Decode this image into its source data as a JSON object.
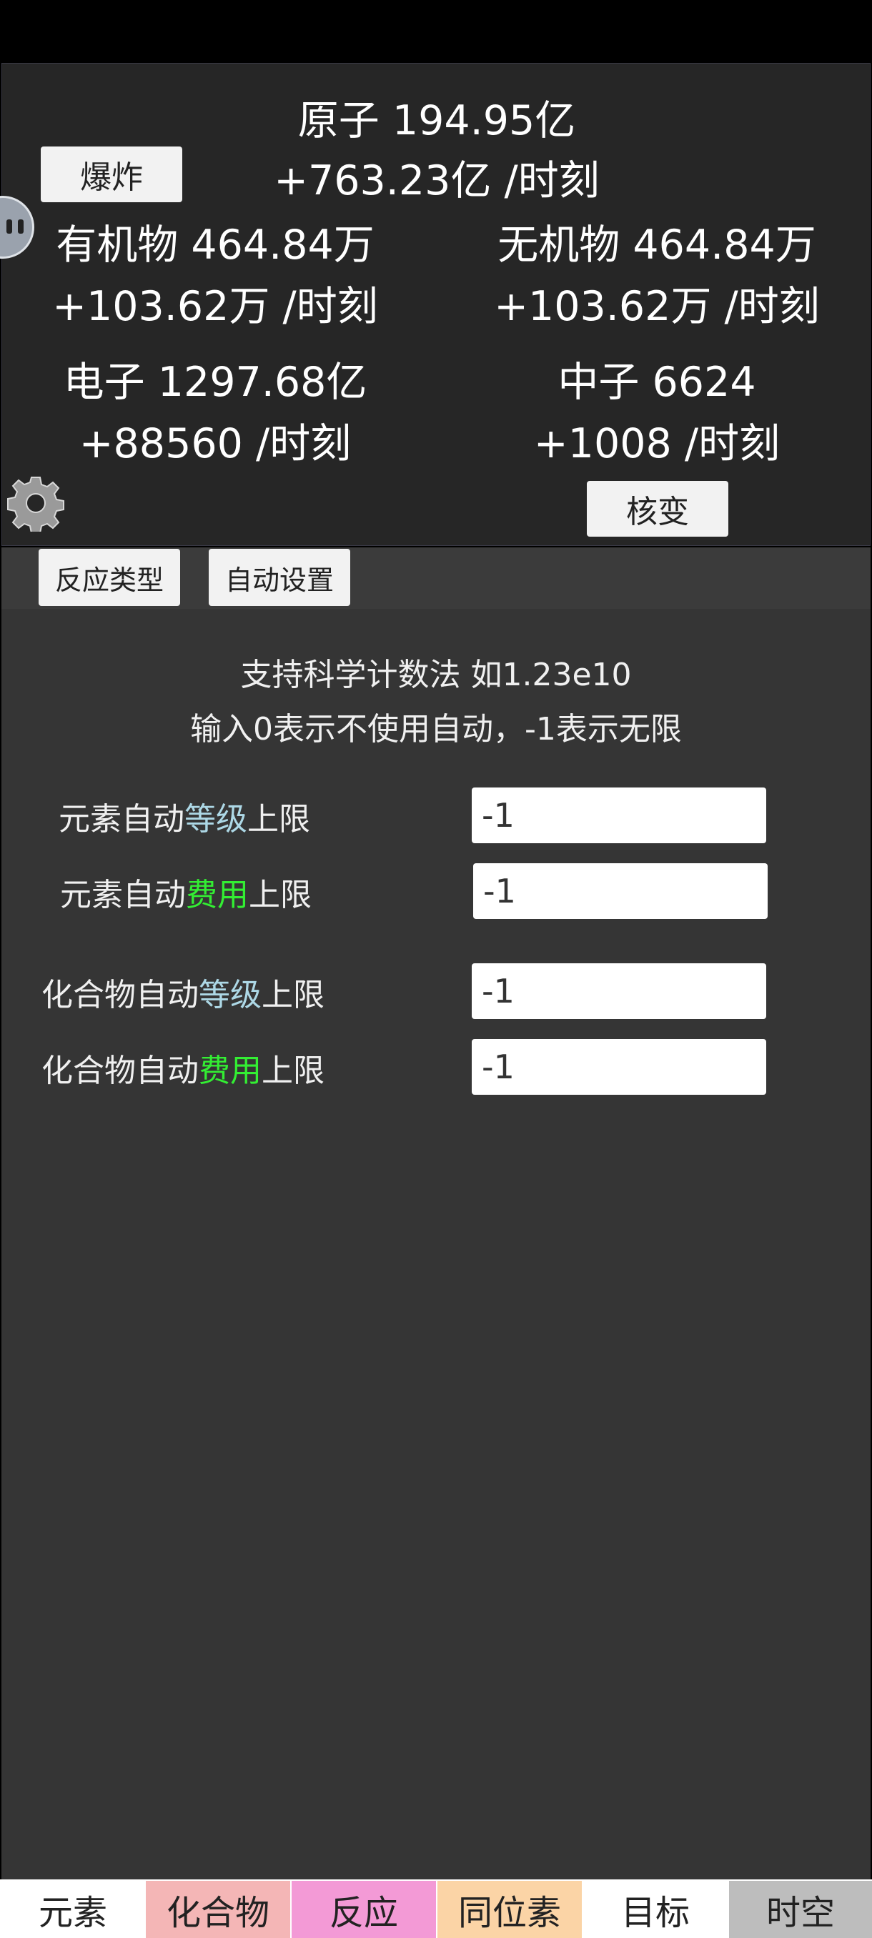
{
  "header": {
    "atom": "原子 194.95亿",
    "atom_rate": "+763.23亿 /时刻",
    "explode_label": "爆炸",
    "organic": "有机物 464.84万",
    "organic_rate": "+103.62万 /时刻",
    "inorganic": "无机物 464.84万",
    "inorganic_rate": "+103.62万 /时刻",
    "electron": "电子 1297.68亿",
    "electron_rate": "+88560 /时刻",
    "neutron": "中子 6624",
    "neutron_rate": "+1008 /时刻",
    "fission_label": "核变",
    "settings_icon": "gear-icon",
    "side_badge_icon": "assistant-badge-icon"
  },
  "sub_tabs": [
    "反应类型",
    "自动设置"
  ],
  "auto": {
    "note1": "支持科学计数法 如1.23e10",
    "note2": "输入0表示不使用自动，-1表示无限",
    "rows": [
      {
        "prefix": "元素自动",
        "highlight": "等级",
        "suffix": "上限",
        "value": "-1"
      },
      {
        "prefix": "元素自动",
        "highlight": "费用",
        "suffix": "上限",
        "value": "-1"
      },
      {
        "prefix": "化合物自动",
        "highlight": "等级",
        "suffix": "上限",
        "value": "-1"
      },
      {
        "prefix": "化合物自动",
        "highlight": "费用",
        "suffix": "上限",
        "value": "-1"
      }
    ]
  },
  "bottom_nav": [
    {
      "label": "元素",
      "color": "#ffffff"
    },
    {
      "label": "化合物",
      "color": "#f4b6b6"
    },
    {
      "label": "反应",
      "color": "#f39ad6"
    },
    {
      "label": "同位素",
      "color": "#fbd4a6"
    },
    {
      "label": "目标",
      "color": "#ffffff"
    },
    {
      "label": "时空",
      "color": "#bdbdbd"
    }
  ],
  "colors": {
    "level_highlight": "#add8e6",
    "cost_highlight": "#33ee33",
    "panel_bg": "#262626",
    "content_bg": "#353535"
  }
}
